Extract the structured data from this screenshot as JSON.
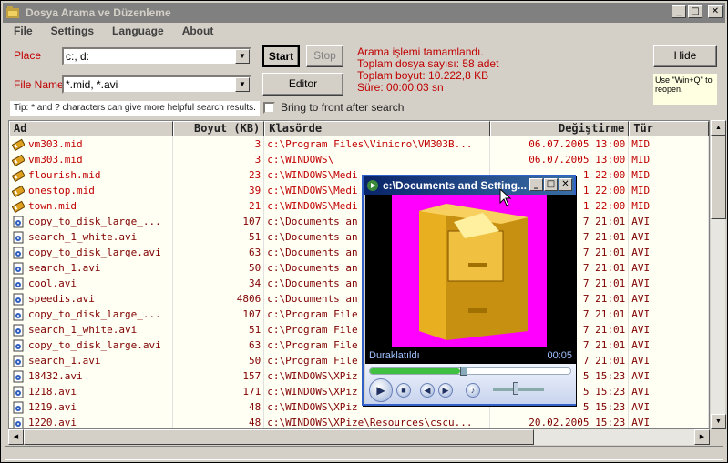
{
  "window": {
    "title": "Dosya Arama ve Düzenleme",
    "buttons": {
      "minimize": "_",
      "maximize": "□",
      "close": "✕"
    }
  },
  "menu": [
    "File",
    "Settings",
    "Language",
    "About"
  ],
  "search": {
    "place_label": "Place",
    "place_value": "c:, d:",
    "filename_label": "File Name",
    "filename_value": "*.mid, *.avi",
    "start_label": "Start",
    "stop_label": "Stop",
    "editor_label": "Editor",
    "tip": "Tip: * and ? characters can give more helpful search results.",
    "bring_front_label": "Bring to front after search"
  },
  "status": {
    "line1": "Arama işlemi tamamlandı.",
    "line2": "Toplam dosya sayısı: 58 adet",
    "line3": "Toplam boyut: 10.222,8 KB",
    "line4": "Süre: 00:00:03 sn"
  },
  "hide": {
    "label": "Hide",
    "note": "Use \"Win+Q\" to reopen."
  },
  "table": {
    "headers": {
      "name": "Ad",
      "size": "Boyut (KB)",
      "dir": "Klasörde",
      "date": "Değiştirme",
      "type": "Tür"
    },
    "rows": [
      {
        "name": "vm303.mid",
        "size": "3",
        "dir": "c:\\Program Files\\Vimicro\\VM303B...",
        "date": "06.07.2005 13:00",
        "type": "MID"
      },
      {
        "name": "vm303.mid",
        "size": "3",
        "dir": "c:\\WINDOWS\\",
        "date": "06.07.2005 13:00",
        "type": "MID"
      },
      {
        "name": "flourish.mid",
        "size": "23",
        "dir": "c:\\WINDOWS\\Medi",
        "date": "1 22:00",
        "type": "MID"
      },
      {
        "name": "onestop.mid",
        "size": "39",
        "dir": "c:\\WINDOWS\\Medi",
        "date": "1 22:00",
        "type": "MID"
      },
      {
        "name": "town.mid",
        "size": "21",
        "dir": "c:\\WINDOWS\\Medi",
        "date": "1 22:00",
        "type": "MID"
      },
      {
        "name": "copy_to_disk_large_...",
        "size": "107",
        "dir": "c:\\Documents an",
        "date": "7 21:01",
        "type": "AVI"
      },
      {
        "name": "search_1_white.avi",
        "size": "51",
        "dir": "c:\\Documents an",
        "date": "7 21:01",
        "type": "AVI"
      },
      {
        "name": "copy_to_disk_large.avi",
        "size": "63",
        "dir": "c:\\Documents an",
        "date": "7 21:01",
        "type": "AVI"
      },
      {
        "name": "search_1.avi",
        "size": "50",
        "dir": "c:\\Documents an",
        "date": "7 21:01",
        "type": "AVI"
      },
      {
        "name": "cool.avi",
        "size": "34",
        "dir": "c:\\Documents an",
        "date": "7 21:01",
        "type": "AVI"
      },
      {
        "name": "speedis.avi",
        "size": "4806",
        "dir": "c:\\Documents an",
        "date": "7 21:01",
        "type": "AVI"
      },
      {
        "name": "copy_to_disk_large_...",
        "size": "107",
        "dir": "c:\\Program File",
        "date": "7 21:01",
        "type": "AVI"
      },
      {
        "name": "search_1_white.avi",
        "size": "51",
        "dir": "c:\\Program File",
        "date": "7 21:01",
        "type": "AVI"
      },
      {
        "name": "copy_to_disk_large.avi",
        "size": "63",
        "dir": "c:\\Program File",
        "date": "7 21:01",
        "type": "AVI"
      },
      {
        "name": "search_1.avi",
        "size": "50",
        "dir": "c:\\Program File",
        "date": "7 21:01",
        "type": "AVI"
      },
      {
        "name": "18432.avi",
        "size": "157",
        "dir": "c:\\WINDOWS\\XPiz",
        "date": "5 15:23",
        "type": "AVI"
      },
      {
        "name": "1218.avi",
        "size": "171",
        "dir": "c:\\WINDOWS\\XPiz",
        "date": "5 15:23",
        "type": "AVI"
      },
      {
        "name": "1219.avi",
        "size": "48",
        "dir": "c:\\WINDOWS\\XPiz",
        "date": "5 15:23",
        "type": "AVI"
      },
      {
        "name": "1220.avi",
        "size": "48",
        "dir": "c:\\WINDOWS\\XPize\\Resources\\cscu...",
        "date": "20.02.2005 15:23",
        "type": "AVI"
      }
    ]
  },
  "player": {
    "title": "c:\\Documents and Setting...",
    "state": "Duraklatıldı",
    "time": "00:05",
    "progress_fraction": 0.45,
    "volume_fraction": 0.4
  }
}
